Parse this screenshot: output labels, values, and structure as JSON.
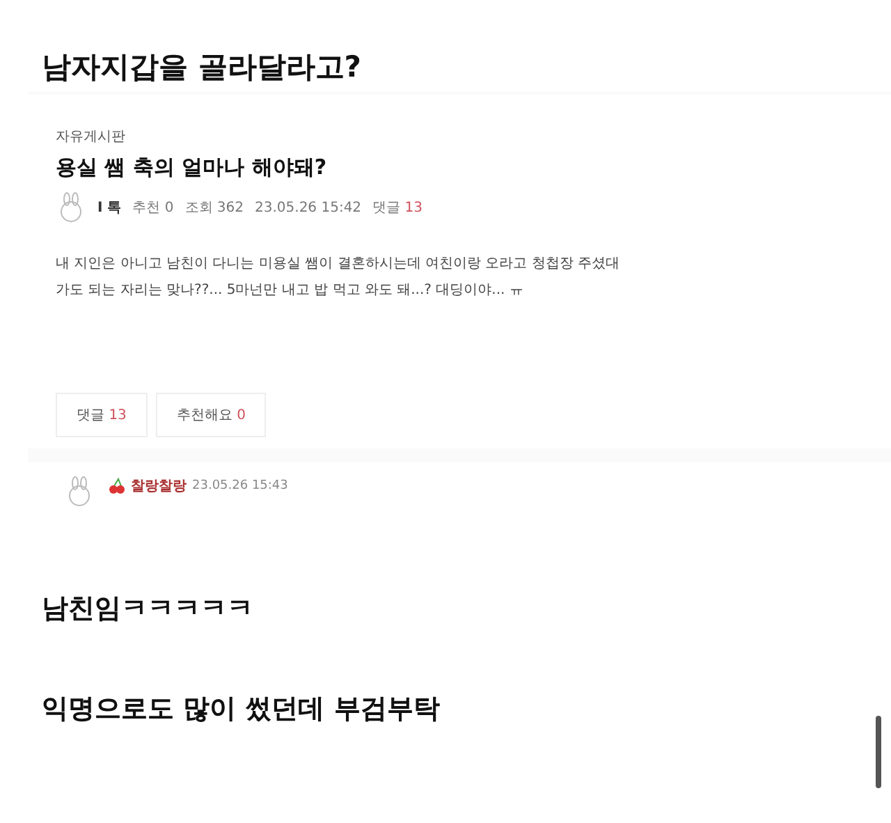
{
  "post_title": "남자지갑을 골라달라고?",
  "embedded_post": {
    "board": "자유게시판",
    "title": "용실 쌤 축의 얼마나 해야돼?",
    "author": "I 톡",
    "likes": "추천 0",
    "views": "조회 362",
    "date": "23.05.26 15:42",
    "comments_label": "댓글",
    "comments_count": "13",
    "body": "내 지인은 아니고 남친이 다니는 미용실 쌤이 결혼하시는데 여친이랑 오라고 청첩장 주셨대\n가도 되는 자리는 맞나??... 5마넌만 내고 밥 먹고 와도 돼...? 대딩이야... ㅠ",
    "buttons": [
      {
        "label": "댓글",
        "count": "13"
      },
      {
        "label": "추천해요",
        "count": "0"
      }
    ],
    "comment": {
      "author": "찰랑찰랑",
      "date": "23.05.26 15:43"
    }
  },
  "replies": [
    "남친임ㅋㅋㅋㅋㅋ",
    "익명으로도 많이 썼던데 부검부탁"
  ]
}
